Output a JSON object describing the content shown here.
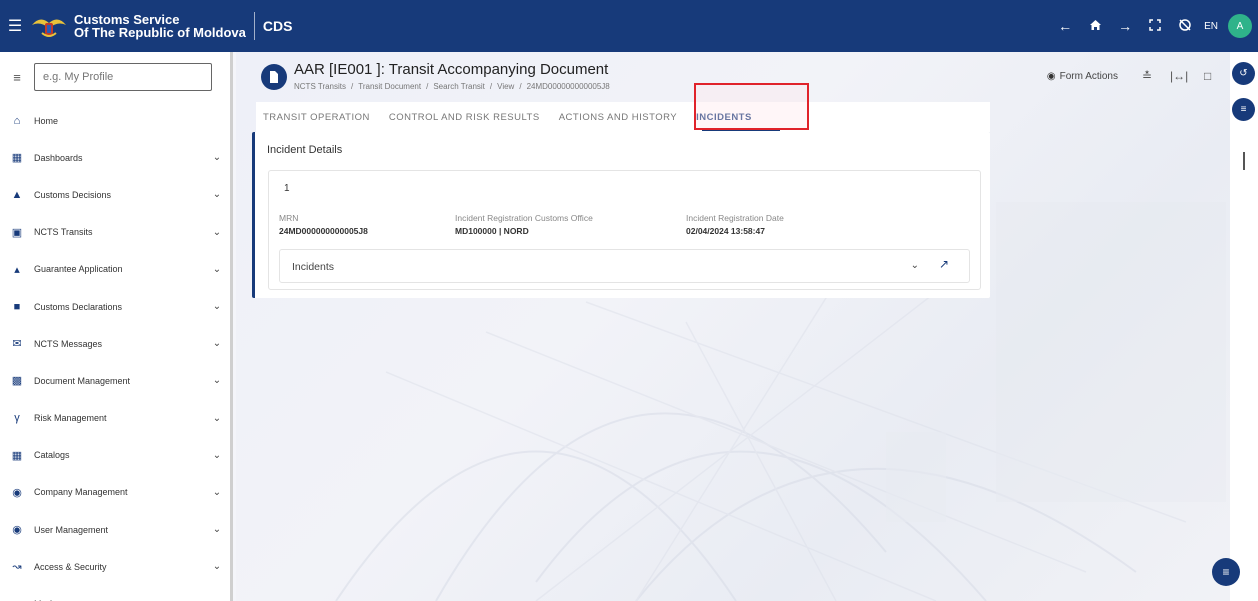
{
  "header": {
    "brand_line1": "Customs Service",
    "brand_line2": "Of The Republic of Moldova",
    "app_name": "CDS",
    "language": "EN",
    "avatar_initial": "A",
    "bar_color": "#173a7a"
  },
  "sidebar": {
    "search_placeholder": "e.g. My Profile",
    "items": [
      {
        "label": "Home",
        "icon": "home-icon",
        "expandable": false
      },
      {
        "label": "Dashboards",
        "icon": "dashboard-icon",
        "expandable": true
      },
      {
        "label": "Customs Decisions",
        "icon": "stamp-icon",
        "expandable": true
      },
      {
        "label": "NCTS Transits",
        "icon": "bus-icon",
        "expandable": true
      },
      {
        "label": "Guarantee Application",
        "icon": "bank-icon",
        "expandable": true
      },
      {
        "label": "Customs Declarations",
        "icon": "box-icon",
        "expandable": true
      },
      {
        "label": "NCTS Messages",
        "icon": "envelope-icon",
        "expandable": true
      },
      {
        "label": "Document Management",
        "icon": "document-icon",
        "expandable": true
      },
      {
        "label": "Risk Management",
        "icon": "fork-icon",
        "expandable": true
      },
      {
        "label": "Catalogs",
        "icon": "grid-icon",
        "expandable": true
      },
      {
        "label": "Company Management",
        "icon": "shield-icon",
        "expandable": true
      },
      {
        "label": "User Management",
        "icon": "user-shield-icon",
        "expandable": true
      },
      {
        "label": "Access & Security",
        "icon": "satellite-icon",
        "expandable": true
      },
      {
        "label": "My Account",
        "icon": "user-icon",
        "expandable": true
      }
    ]
  },
  "page": {
    "title": "AAR [IE001 ]: Transit Accompanying Document",
    "breadcrumb": [
      "NCTS Transits",
      "/",
      "Transit Document",
      "/",
      "Search Transit",
      "/",
      "View",
      "/",
      "24MD000000000005J8"
    ],
    "form_actions_label": "Form Actions"
  },
  "tabs": [
    {
      "label": "TRANSIT OPERATION",
      "active": false
    },
    {
      "label": "CONTROL AND RISK RESULTS",
      "active": false
    },
    {
      "label": "ACTIONS AND HISTORY",
      "active": false
    },
    {
      "label": "INCIDENTS",
      "active": true
    }
  ],
  "incident_details": {
    "title": "Incident Details",
    "entry_number": "1",
    "fields": [
      {
        "label": "MRN",
        "value": "24MD000000000005J8"
      },
      {
        "label": "Incident Registration Customs Office",
        "value": "MD100000 | NORD"
      },
      {
        "label": "Incident Registration Date",
        "value": "02/04/2024 13:58:47"
      }
    ],
    "incidents_section_label": "Incidents"
  }
}
